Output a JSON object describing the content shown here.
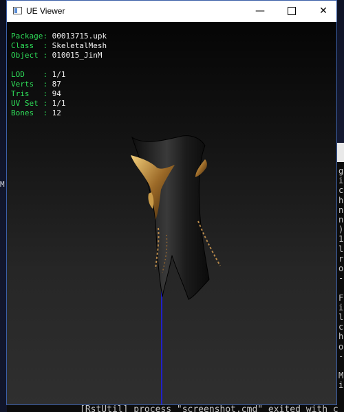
{
  "window": {
    "title": "UE Viewer",
    "minimize_glyph": "—",
    "close_glyph": "✕"
  },
  "info": {
    "package_label": "Package:",
    "package_value": "00013715.upk",
    "class_label": "Class  :",
    "class_value": "SkeletalMesh",
    "object_label": "Object :",
    "object_value": "010015_JinM",
    "lod_label": "LOD    :",
    "lod_value": "1/1",
    "verts_label": "Verts  :",
    "verts_value": "87",
    "tris_label": "Tris   :",
    "tris_value": "94",
    "uvset_label": "UV Set :",
    "uvset_value": "1/1",
    "bones_label": "Bones  :",
    "bones_value": "12"
  },
  "background_console": {
    "bottom_line": "[RstUtil] process \"screenshot.cmd\" exited with c",
    "column_chars": [
      "g",
      "i",
      "c",
      "h",
      "n",
      "n",
      ")",
      "1",
      "l",
      "r",
      "o",
      "-",
      "",
      "F",
      "i",
      "l",
      "c",
      "h",
      "o",
      "-",
      "",
      "M",
      "i"
    ]
  },
  "desktop": {
    "left_edge_char": "M"
  },
  "colors": {
    "info_key": "#2fe05a",
    "info_value": "#f2f2f2",
    "axis": "#2020c8",
    "window_border": "#3b5fa7"
  }
}
